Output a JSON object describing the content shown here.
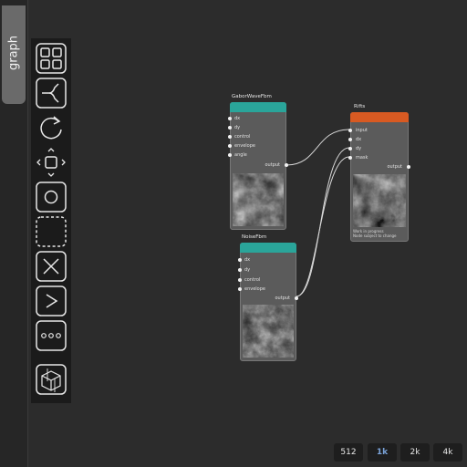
{
  "sidebar": {
    "tab_label": "graph"
  },
  "toolbar": {
    "tools": [
      "grid-icon",
      "branch-icon",
      "rotate-icon",
      "move-icon",
      "circle-icon",
      "dashed-square-icon",
      "cross-icon",
      "greater-than-icon",
      "ellipsis-icon",
      "cube-icon"
    ]
  },
  "nodes": {
    "gabor": {
      "title": "GaborWaveFbm",
      "color": "#2aa59a",
      "inputs": [
        "dx",
        "dy",
        "control",
        "envelope",
        "angle"
      ],
      "output": "output"
    },
    "rifts": {
      "title": "Rifts",
      "color": "#d85a22",
      "inputs": [
        "input",
        "dx",
        "dy",
        "mask"
      ],
      "output": "output",
      "note_line1": "Work in progress",
      "note_line2": "Node subject to change"
    },
    "noise": {
      "title": "NoiseFbm",
      "color": "#2aa59a",
      "inputs": [
        "dx",
        "dy",
        "control",
        "envelope"
      ],
      "output": "output"
    }
  },
  "resolutions": {
    "r512": "512",
    "r1k": "1k",
    "r2k": "2k",
    "r4k": "4k",
    "selected": "1k"
  }
}
